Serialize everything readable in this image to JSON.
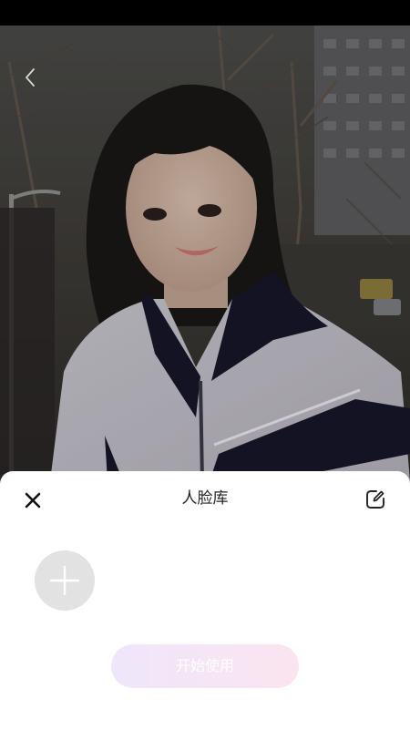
{
  "sheet": {
    "title": "人脸库",
    "start_button_label": "开始使用"
  },
  "icons": {
    "back": "chevron-left-icon",
    "close": "close-icon",
    "edit": "edit-icon",
    "add": "plus-icon"
  },
  "colors": {
    "sheet_background": "#ffffff",
    "add_button_background": "#e2e2e2",
    "start_button_gradient_start": "#efe6fb",
    "start_button_gradient_end": "#fbe4ef",
    "start_button_text": "#ffffff"
  }
}
